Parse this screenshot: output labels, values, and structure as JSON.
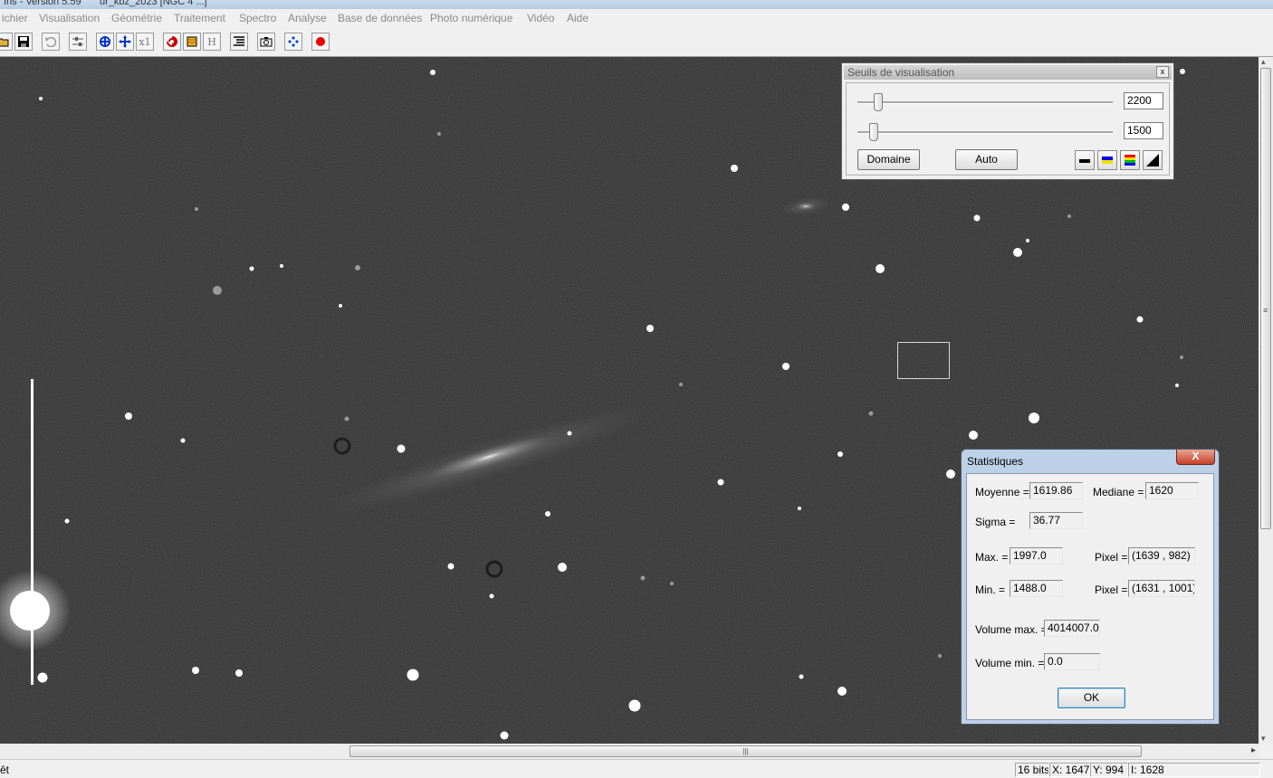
{
  "window": {
    "app_title": "Iris - Version 5.59",
    "file_title": "ur_kbz_2023 [NGC 4 ...]"
  },
  "menu": [
    "ichier",
    "Visualisation",
    "Géométrie",
    "Traitement",
    "Spectro",
    "Analyse",
    "Base de données",
    "Photo numérique",
    "Vidéo",
    "Aide"
  ],
  "toolbar": {
    "buttons": [
      "open-folder-icon",
      "save-icon",
      "undo-icon",
      "adjust-icon",
      "zoom-in-icon",
      "zoom-out-icon",
      "x1-icon",
      "spiral-icon",
      "yellow-square-icon",
      "h-icon",
      "list-icon",
      "camera-icon",
      "diamond-icon",
      "red-dot-icon"
    ],
    "x1_label": "x1",
    "h_label": "H"
  },
  "seuils": {
    "title": "Seuils de visualisation",
    "close": "x",
    "high_value": "2200",
    "low_value": "1500",
    "domaine_label": "Domaine",
    "auto_label": "Auto",
    "palettes": [
      "bw-palette-icon",
      "blue-yellow-palette-icon",
      "rainbow-palette-icon",
      "gradient-palette-icon"
    ]
  },
  "stats": {
    "title": "Statistiques",
    "close": "X",
    "moyenne_label": "Moyenne =",
    "moyenne": "1619.86",
    "mediane_label": "Mediane =",
    "mediane": "1620",
    "sigma_label": "Sigma =",
    "sigma": "36.77",
    "max_label": "Max. =",
    "max": "1997.0",
    "max_pixel_label": "Pixel =",
    "max_pixel": "(1639 , 982)",
    "min_label": "Min. =",
    "min": "1488.0",
    "min_pixel_label": "Pixel =",
    "min_pixel": "(1631 , 1001)",
    "volmax_label": "Volume max. =",
    "volmax": "4014007.0",
    "volmin_label": "Volume min. =",
    "volmin": "0.0",
    "ok_label": "OK"
  },
  "status": {
    "left": "êt",
    "bits": "16 bits",
    "x": "X: 1647",
    "y": "Y: 994",
    "i": "I: 1628"
  },
  "scroll": {
    "hgrip": "|||",
    "hright": "▸",
    "vup": "▴",
    "vgrip": "≡",
    "vdown": "▾"
  },
  "colors": {
    "sky": "#2d2d2d",
    "stats_frame": "#bcd1e8",
    "close_red": "#c7422a"
  }
}
